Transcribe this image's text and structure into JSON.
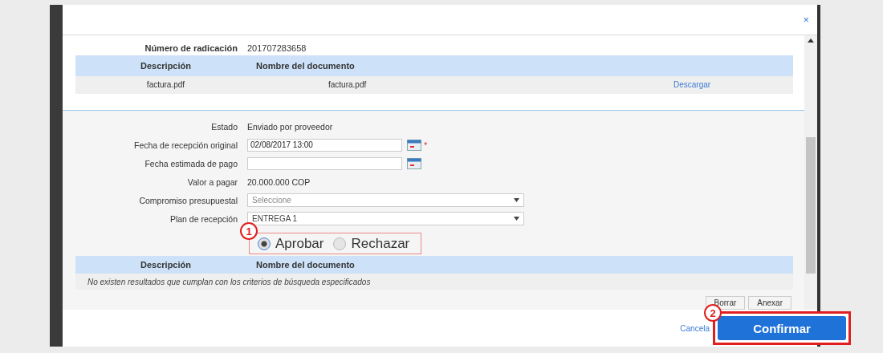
{
  "dialog": {
    "close_label": "×",
    "summary": [
      {
        "label": "Número de radicación",
        "value": "201707283658"
      }
    ],
    "documents_table": {
      "columns": [
        "Descripción",
        "Nombre del documento"
      ],
      "rows": [
        {
          "cells": [
            "factura.pdf",
            "factura.pdf"
          ],
          "action": "Descargar"
        }
      ]
    },
    "form": {
      "fields": [
        {
          "kind": "text",
          "label": "Estado",
          "value": "Enviado por proveedor"
        },
        {
          "kind": "date",
          "label": "Fecha de recepción original",
          "value": "02/08/2017 13:00",
          "required_mark": "*"
        },
        {
          "kind": "date",
          "label": "Fecha estimada de pago"
        },
        {
          "kind": "text",
          "label": "Valor a pagar",
          "value": "20.000.000 COP"
        },
        {
          "kind": "select",
          "label": "Compromiso presupuestal",
          "placeholder": "Seleccione"
        },
        {
          "kind": "select",
          "label": "Plan de recepción",
          "value": "ENTREGA 1"
        }
      ]
    },
    "decision": {
      "annotation": "1",
      "options": [
        {
          "label": "Aprobar",
          "selected": true
        },
        {
          "label": "Rechazar",
          "selected": false
        }
      ]
    },
    "attachments_table": {
      "columns": [
        "Descripción",
        "Nombre del documento"
      ],
      "empty_message": "No existen resultados que cumplan con los criterios de búsqueda especificados"
    },
    "buttons": [
      "Borrar",
      "Anexar"
    ],
    "footer": {
      "cancel": "Cancela",
      "confirm": "Confirmar",
      "confirm_annotation": "2"
    }
  }
}
